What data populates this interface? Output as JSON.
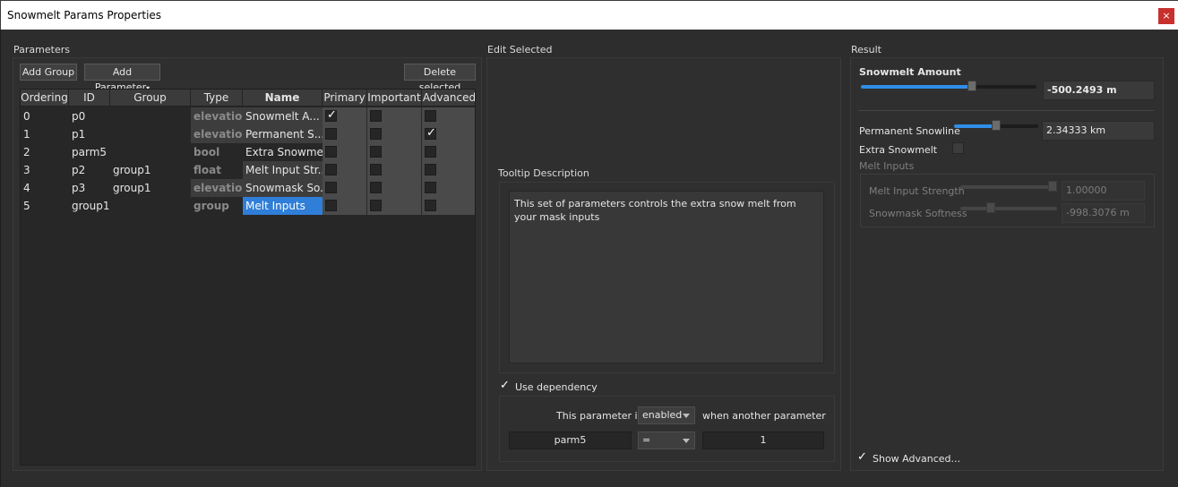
{
  "window": {
    "title": "Snowmelt Params Properties",
    "close_glyph": "×"
  },
  "sections": {
    "parameters": "Parameters",
    "edit_selected": "Edit Selected",
    "result": "Result"
  },
  "toolbar": {
    "add_group": "Add Group",
    "add_parameter": "Add Parameter",
    "delete_selected": "Delete selected"
  },
  "table": {
    "columns": [
      "Ordering",
      "ID",
      "Group",
      "Type",
      "Name",
      "Primary",
      "Important",
      "Advanced"
    ],
    "rows": [
      {
        "ordering": "0",
        "id": "p0",
        "group": "",
        "type": "elevation",
        "name": "Snowmelt A...",
        "primary": true,
        "important": false,
        "advanced": false
      },
      {
        "ordering": "1",
        "id": "p1",
        "group": "",
        "type": "elevation",
        "name": "Permanent S...",
        "primary": false,
        "important": false,
        "advanced": true
      },
      {
        "ordering": "2",
        "id": "parm5",
        "group": "",
        "type": "bool",
        "name": "Extra Snowmelt",
        "primary": false,
        "important": false,
        "advanced": false
      },
      {
        "ordering": "3",
        "id": "p2",
        "group": "group1",
        "type": "float",
        "name": "Melt Input Str...",
        "primary": false,
        "important": false,
        "advanced": false
      },
      {
        "ordering": "4",
        "id": "p3",
        "group": "group1",
        "type": "elevation",
        "name": "Snowmask So...",
        "primary": false,
        "important": false,
        "advanced": false
      },
      {
        "ordering": "5",
        "id": "group1",
        "group": "",
        "type": "group",
        "name": "Melt Inputs",
        "primary": false,
        "important": false,
        "advanced": false,
        "selected": true
      }
    ]
  },
  "edit": {
    "tooltip_label": "Tooltip Description",
    "tooltip_text": "This set of parameters controls the extra snow melt from your mask inputs",
    "use_dependency_label": "Use dependency",
    "use_dependency_checked": true,
    "this_parameter_is": "This parameter is",
    "state_value": "enabled",
    "when_another": "when another parameter",
    "dep_param": "parm5",
    "dep_operator": "=",
    "dep_value": "1"
  },
  "result": {
    "snowmelt_amount_label": "Snowmelt Amount",
    "snowmelt_amount_value": "-500.2493 m",
    "snowmelt_amount_level": 0.64,
    "permanent_snowline_label": "Permanent Snowline",
    "permanent_snowline_value": "2.34333 km",
    "permanent_snowline_level": 0.5,
    "extra_snowmelt_label": "Extra Snowmelt",
    "melt_inputs_label": "Melt Inputs",
    "melt_input_strength_label": "Melt Input Strength",
    "melt_input_strength_value": "1.00000",
    "melt_input_strength_level": 1.0,
    "snowmask_softness_label": "Snowmask Softness",
    "snowmask_softness_value": "-998.3076 m",
    "snowmask_softness_level": 0.3,
    "show_advanced_label": "Show Advanced..."
  },
  "colors": {
    "accent": "#2f8ee8",
    "selection": "#2f7ed8",
    "close": "#c8302d"
  }
}
